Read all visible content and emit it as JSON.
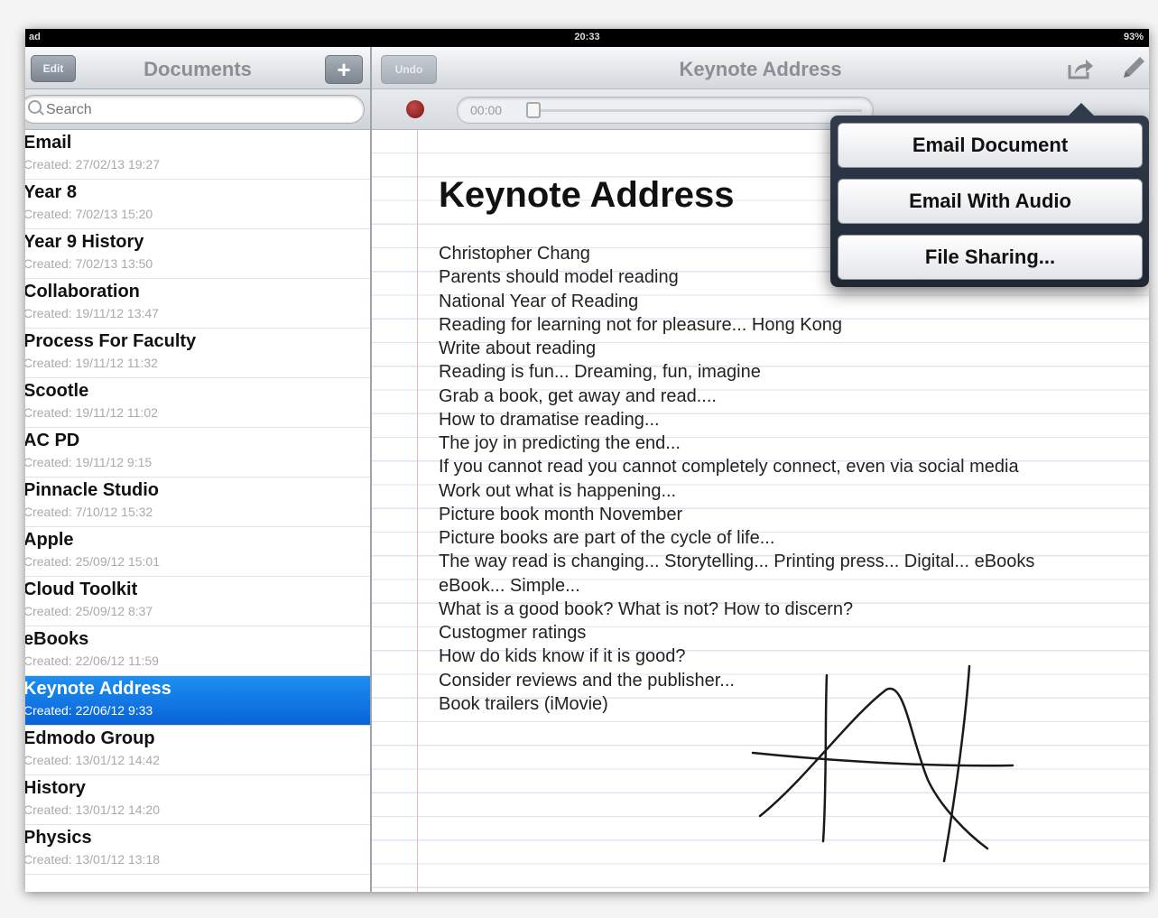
{
  "status_bar": {
    "carrier": "ad",
    "time": "20:33",
    "battery": "93%"
  },
  "sidebar": {
    "title": "Documents",
    "edit_label": "Edit",
    "add_label": "+",
    "search_placeholder": "Search",
    "documents": [
      {
        "name": "Email",
        "created": "Created: 27/02/13 19:27"
      },
      {
        "name": "Year 8",
        "created": "Created: 7/02/13 15:20"
      },
      {
        "name": "Year 9 History",
        "created": "Created: 7/02/13 13:50"
      },
      {
        "name": "Collaboration",
        "created": "Created: 19/11/12 13:47"
      },
      {
        "name": "Process For Faculty",
        "created": "Created: 19/11/12 11:32"
      },
      {
        "name": "Scootle",
        "created": "Created: 19/11/12 11:02"
      },
      {
        "name": "AC PD",
        "created": "Created: 19/11/12 9:15"
      },
      {
        "name": "Pinnacle Studio",
        "created": "Created: 7/10/12 15:32"
      },
      {
        "name": "Apple",
        "created": "Created: 25/09/12 15:01"
      },
      {
        "name": "Cloud Toolkit",
        "created": "Created: 25/09/12 8:37"
      },
      {
        "name": "eBooks",
        "created": "Created: 22/06/12 11:59"
      },
      {
        "name": "Keynote Address",
        "created": "Created: 22/06/12 9:33",
        "selected": true
      },
      {
        "name": "Edmodo Group",
        "created": "Created: 13/01/12 14:42"
      },
      {
        "name": "History",
        "created": "Created: 13/01/12 14:20"
      },
      {
        "name": "Physics",
        "created": "Created: 13/01/12 13:18"
      }
    ]
  },
  "editor": {
    "title": "Keynote Address",
    "undo_label": "Undo",
    "recorder_time": "00:00",
    "heading": "Keynote Address",
    "lines": [
      "Christopher Chang",
      "Parents should model reading",
      "National Year of Reading",
      "Reading for learning not for pleasure... Hong Kong",
      "Write about reading",
      "Reading is fun... Dreaming, fun, imagine",
      "Grab a book, get away and read....",
      "How to dramatise reading...",
      "The joy in predicting the end...",
      "If you cannot read you cannot completely connect, even via social media",
      "Work out what is happening...",
      "Picture book month  November",
      "Picture books are part of the cycle of life...",
      "The way read is changing... Storytelling... Printing press... Digital... eBooks",
      "eBook... Simple...",
      "What is a good book? What is not? How to discern?",
      "Custogmer ratings",
      "How do kids know if it is good?",
      "Consider reviews and the publisher...",
      "Book trailers (iMovie)"
    ]
  },
  "share_menu": {
    "email_document": "Email Document",
    "email_with_audio": "Email With Audio",
    "file_sharing": "File Sharing..."
  },
  "colors": {
    "selection": "#0a63d8",
    "record": "#7a1414",
    "popover": "#1f2733"
  }
}
